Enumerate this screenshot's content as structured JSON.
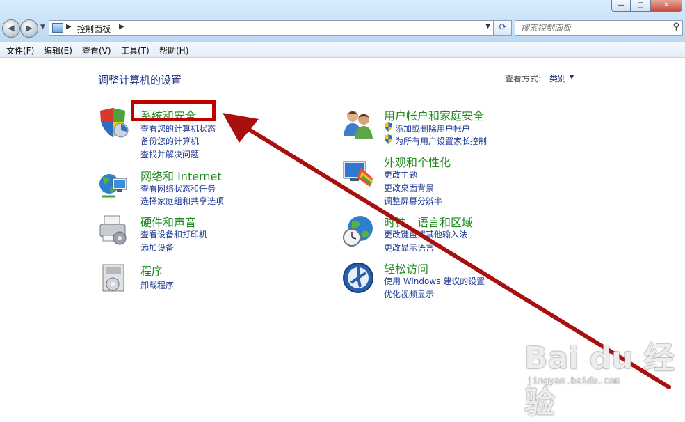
{
  "window": {
    "minimize_symbol": "—",
    "maximize_symbol": "□",
    "close_symbol": "✕"
  },
  "nav": {
    "back_icon": "arrow-left-icon",
    "forward_icon": "arrow-right-icon",
    "address": {
      "crumb": "控制面板",
      "separator": "▶",
      "dropdown": "▼"
    },
    "refresh_icon": "refresh-icon",
    "search": {
      "placeholder": "搜索控制面板",
      "icon": "search-icon"
    }
  },
  "menu": [
    {
      "label": "文件(F)"
    },
    {
      "label": "编辑(E)"
    },
    {
      "label": "查看(V)"
    },
    {
      "label": "工具(T)"
    },
    {
      "label": "帮助(H)"
    }
  ],
  "content": {
    "heading": "调整计算机的设置",
    "view_by_label": "查看方式:",
    "view_by_value": "类别",
    "view_by_arrow": "▼",
    "categories": [
      {
        "title": "系统和安全",
        "icon": "system-security-icon",
        "links": [
          "查看您的计算机状态",
          "备份您的计算机",
          "查找并解决问题"
        ]
      },
      {
        "title": "网络和 Internet",
        "icon": "network-icon",
        "links": [
          "查看网络状态和任务",
          "选择家庭组和共享选项"
        ]
      },
      {
        "title": "硬件和声音",
        "icon": "printer-icon",
        "links": [
          "查看设备和打印机",
          "添加设备"
        ]
      },
      {
        "title": "程序",
        "icon": "programs-icon",
        "links": [
          "卸载程序"
        ]
      },
      {
        "title": "用户帐户和家庭安全",
        "icon": "users-icon",
        "links": [
          "添加或删除用户帐户",
          "为所有用户设置家长控制"
        ]
      },
      {
        "title": "外观和个性化",
        "icon": "appearance-icon",
        "links": [
          "更改主题",
          "更改桌面背景",
          "调整屏幕分辨率"
        ]
      },
      {
        "title": "时钟、语言和区域",
        "icon": "clock-globe-icon",
        "links": [
          "更改键盘或其他输入法",
          "更改显示语言"
        ]
      },
      {
        "title": "轻松访问",
        "icon": "ease-of-access-icon",
        "links": [
          "使用 Windows 建议的设置",
          "优化视频显示"
        ]
      }
    ]
  },
  "watermark": {
    "logo": "Bai du 经验",
    "url": "jingyan.baidu.com"
  },
  "colors": {
    "highlight": "#c00000",
    "category_title": "#1f8a1f",
    "link": "#1e3a96"
  }
}
